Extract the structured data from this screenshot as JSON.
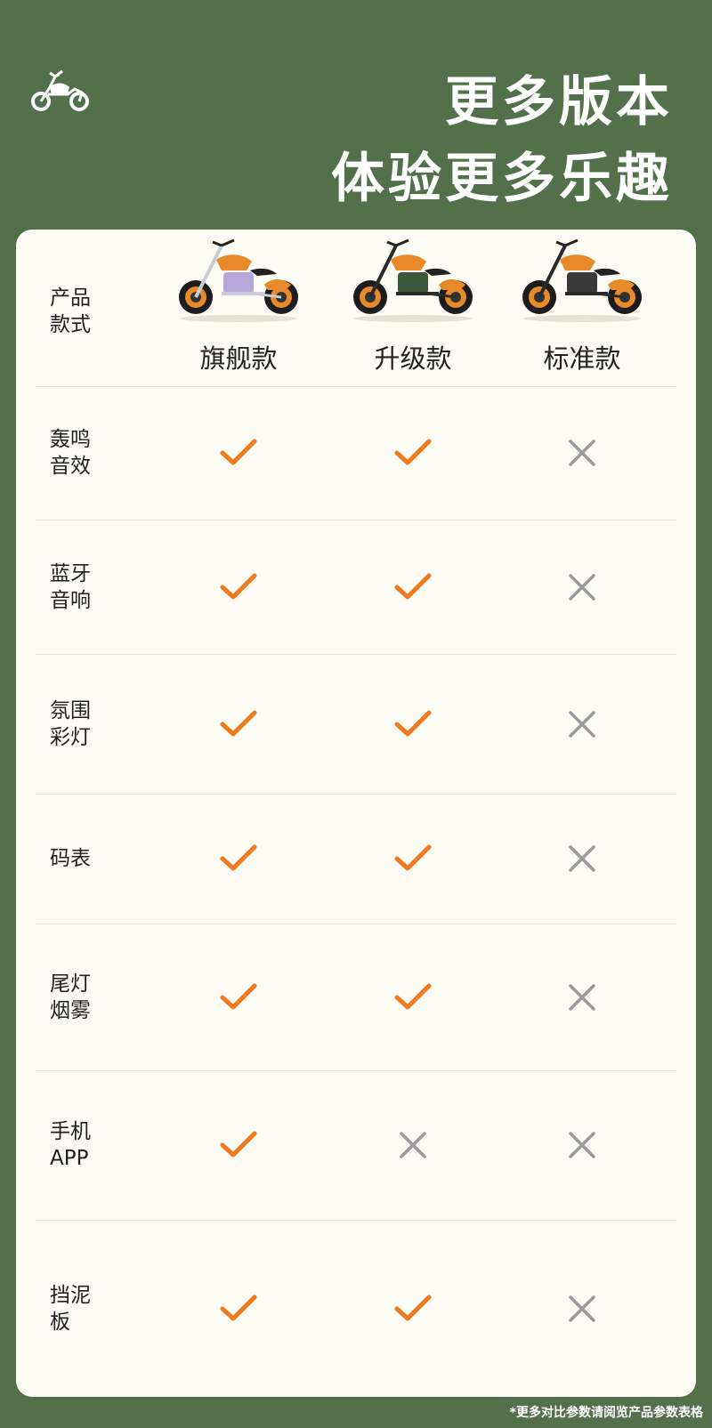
{
  "header": {
    "logo_icon": "motorcycle-icon",
    "title_line1": "更多版本",
    "title_line2": "体验更多乐趣"
  },
  "table": {
    "corner_label": "产品\n款式",
    "columns": [
      {
        "name": "旗舰款",
        "image": "motorcycle-flagship-photo"
      },
      {
        "name": "升级款",
        "image": "motorcycle-upgrade-photo"
      },
      {
        "name": "标准款",
        "image": "motorcycle-standard-photo"
      }
    ],
    "rows": [
      {
        "label": "轰鸣\n音效",
        "values": [
          true,
          true,
          false
        ]
      },
      {
        "label": "蓝牙\n音响",
        "values": [
          true,
          true,
          false
        ]
      },
      {
        "label": "氛围\n彩灯",
        "values": [
          true,
          true,
          false
        ]
      },
      {
        "label": "码表",
        "values": [
          true,
          true,
          false
        ]
      },
      {
        "label": "尾灯\n烟雾",
        "values": [
          true,
          true,
          false
        ]
      },
      {
        "label": "手机\nAPP",
        "values": [
          true,
          false,
          false
        ]
      },
      {
        "label": "挡泥\n板",
        "values": [
          true,
          true,
          false
        ]
      }
    ]
  },
  "footnote": "*更多对比参数请阅览产品参数表格",
  "colors": {
    "background": "#52714b",
    "card": "#fcfbf4",
    "check": "#ef7a1f",
    "cross": "#9a9a9a",
    "bike_body": "#e98a2a"
  },
  "icons": {
    "check": "check-icon",
    "cross": "cross-icon"
  }
}
